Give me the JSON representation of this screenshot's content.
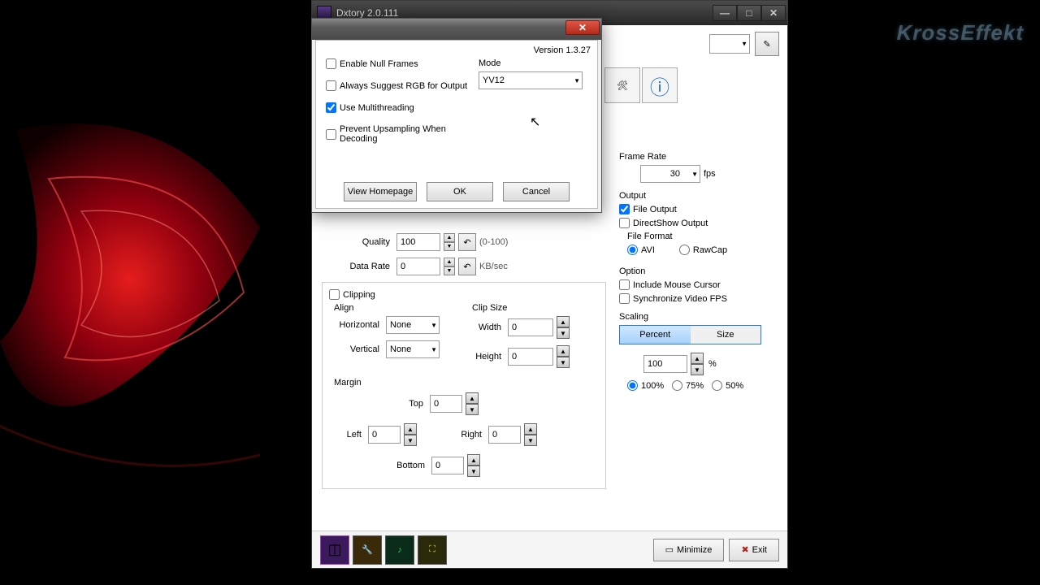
{
  "watermark": "KrossEffekt",
  "mainWindow": {
    "title": "Dxtory 2.0.111"
  },
  "topbar": {
    "edit": "✎"
  },
  "tabs": {
    "tools": "🛠",
    "info": "ⓘ"
  },
  "video": {
    "qualityLabel": "Quality",
    "qualityValue": "100",
    "qualityHint": "(0-100)",
    "dataRateLabel": "Data Rate",
    "dataRateValue": "0",
    "dataRateUnit": "KB/sec"
  },
  "clipping": {
    "label": "Clipping",
    "alignLabel": "Align",
    "horizontalLabel": "Horizontal",
    "horizontalValue": "None",
    "verticalLabel": "Vertical",
    "verticalValue": "None",
    "clipSizeLabel": "Clip Size",
    "widthLabel": "Width",
    "widthValue": "0",
    "heightLabel": "Height",
    "heightValue": "0",
    "marginLabel": "Margin",
    "topLabel": "Top",
    "topValue": "0",
    "leftLabel": "Left",
    "leftValue": "0",
    "rightLabel": "Right",
    "rightValue": "0",
    "bottomLabel": "Bottom",
    "bottomValue": "0"
  },
  "right": {
    "frameRateLabel": "Frame Rate",
    "frameRateValue": "30",
    "fpsLabel": "fps",
    "outputLabel": "Output",
    "fileOutput": "File Output",
    "directShow": "DirectShow Output",
    "fileFormatLabel": "File Format",
    "avi": "AVI",
    "rawcap": "RawCap",
    "optionLabel": "Option",
    "mouseCursor": "Include Mouse Cursor",
    "syncFps": "Synchronize Video FPS",
    "scalingLabel": "Scaling",
    "percent": "Percent",
    "size": "Size",
    "scaleValue": "100",
    "percentSign": "%",
    "scale100": "100%",
    "scale75": "75%",
    "scale50": "50%"
  },
  "footer": {
    "minimize": "Minimize",
    "exit": "Exit"
  },
  "dialog": {
    "version": "Version 1.3.27",
    "enableNull": "Enable Null Frames",
    "alwaysRgb": "Always Suggest RGB for Output",
    "useMulti": "Use Multithreading",
    "preventUpsample": "Prevent Upsampling When Decoding",
    "modeLabel": "Mode",
    "modeValue": "YV12",
    "viewHomepage": "View Homepage",
    "ok": "OK",
    "cancel": "Cancel"
  }
}
